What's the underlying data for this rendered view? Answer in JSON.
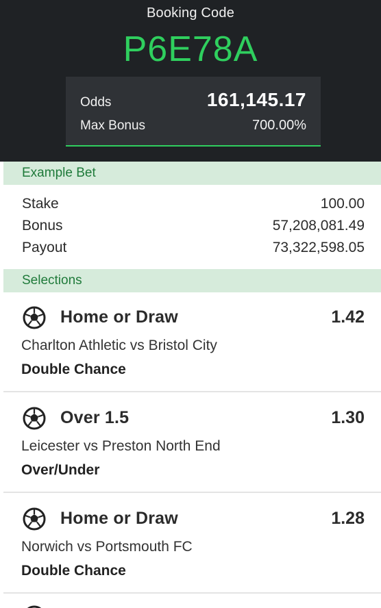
{
  "header": {
    "booking_label": "Booking Code",
    "booking_code": "P6E78A",
    "odds_label": "Odds",
    "odds_value": "161,145.17",
    "max_bonus_label": "Max Bonus",
    "max_bonus_value": "700.00%"
  },
  "example_bet": {
    "title": "Example Bet",
    "rows": [
      {
        "label": "Stake",
        "value": "100.00"
      },
      {
        "label": "Bonus",
        "value": "57,208,081.49"
      },
      {
        "label": "Payout",
        "value": "73,322,598.05"
      }
    ]
  },
  "selections": {
    "title": "Selections",
    "items": [
      {
        "icon": "soccer-ball-icon",
        "pick": "Home or Draw",
        "odds": "1.42",
        "match": "Charlton Athletic vs Bristol City",
        "market": "Double Chance"
      },
      {
        "icon": "soccer-ball-icon",
        "pick": "Over 1.5",
        "odds": "1.30",
        "match": "Leicester vs Preston North End",
        "market": "Over/Under"
      },
      {
        "icon": "soccer-ball-icon",
        "pick": "Home or Draw",
        "odds": "1.28",
        "match": "Norwich vs Portsmouth FC",
        "market": "Double Chance"
      }
    ]
  },
  "colors": {
    "header_bg": "#1f2225",
    "accent_green": "#2fcf5e",
    "section_bg": "#d6ebdb",
    "section_text": "#1f7a3a"
  }
}
